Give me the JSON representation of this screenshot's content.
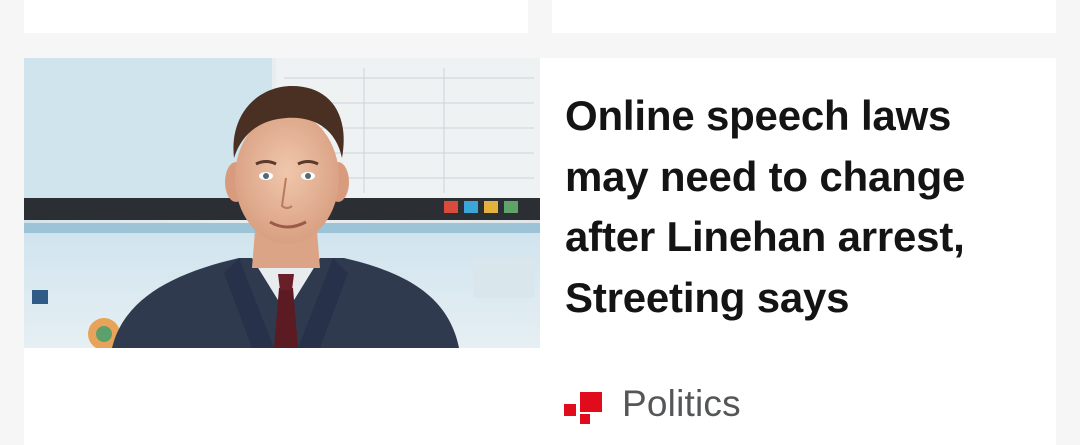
{
  "story": {
    "headline": "Online speech laws may need to change after Linehan arrest, Streeting says",
    "section_label": "Politics",
    "section_icon": "section-marker-icon",
    "accent_color": "#e00b1b"
  }
}
